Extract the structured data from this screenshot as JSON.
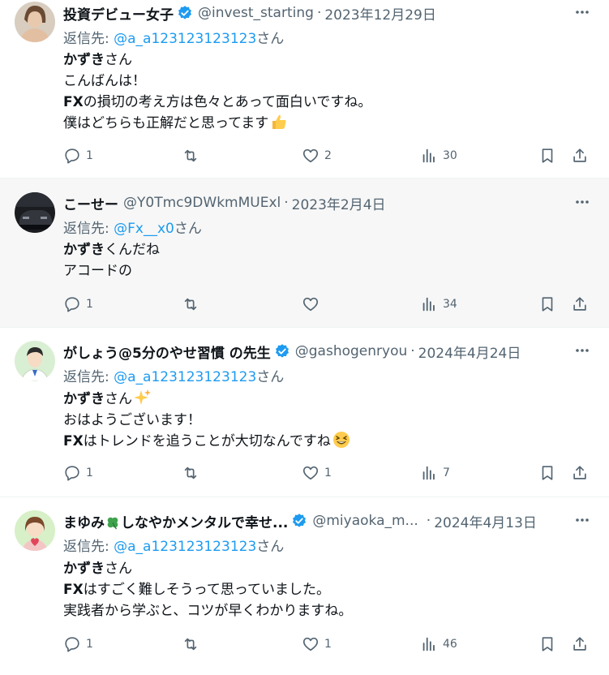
{
  "tweets": [
    {
      "name": "投資デビュー女子",
      "verified": true,
      "handle": "@invest_starting",
      "date": "2023年12月29日",
      "reply_label": "返信先:",
      "reply_handle": "@a_a123123123123",
      "reply_suffix": "さん",
      "line1_bold": "かずき",
      "line1_rest": "さん",
      "line2": "こんばんは！",
      "line3_bold": "FX",
      "line3_rest": "の損切の考え方は色々とあって面白いですね。",
      "line4": "僕はどちらも正解だと思ってます",
      "emoji": "thumbs-up-emoji",
      "replies": "1",
      "reposts": "",
      "likes": "2",
      "views": "30"
    },
    {
      "name": "こーせー",
      "verified": false,
      "handle": "@Y0Tmc9DWkmMUExl",
      "date": "2023年2月4日",
      "reply_label": "返信先:",
      "reply_handle": "@Fx__x0",
      "reply_suffix": "さん",
      "line1_bold": "かずき",
      "line1_rest": "くんだね",
      "line2": "アコードの",
      "replies": "1",
      "reposts": "",
      "likes": "",
      "views": "34"
    },
    {
      "name": "がしょう@5分のやせ習慣 の先生",
      "verified": true,
      "handle": "@gashogenryou",
      "date": "2024年4月24日",
      "reply_label": "返信先:",
      "reply_handle": "@a_a123123123123",
      "reply_suffix": "さん",
      "line1_bold": "かずき",
      "line1_rest": "さん",
      "line1_emoji": "sparkles-emoji",
      "line2": "おはようございます！",
      "line3_bold": "FX",
      "line3_rest": "はトレンドを追うことが大切なんですね",
      "line3_emoji": "grinning-squint-emoji",
      "replies": "1",
      "reposts": "",
      "likes": "1",
      "views": "7"
    },
    {
      "name": "まゆみ🍀しなやかメンタルで幸せ...",
      "name_a": "まゆみ",
      "name_b": "しなやかメンタルで幸せ...",
      "verified": true,
      "handle": "@miyaoka_m...",
      "date": "2024年4月13日",
      "reply_label": "返信先:",
      "reply_handle": "@a_a123123123123",
      "reply_suffix": "さん",
      "line1_bold": "かずき",
      "line1_rest": "さん",
      "line2_bold": "FX",
      "line2_rest": "はすごく難しそうって思っていました。",
      "line3": "実践者から学ぶと、コツが早くわかりますね。",
      "replies": "1",
      "reposts": "",
      "likes": "1",
      "views": "46"
    }
  ],
  "colors": {
    "text": "#0f1419",
    "secondary": "#536471",
    "link": "#1d9bf0",
    "verified": "#1d9bf0",
    "highlight_bg": "#f7f7f7"
  }
}
